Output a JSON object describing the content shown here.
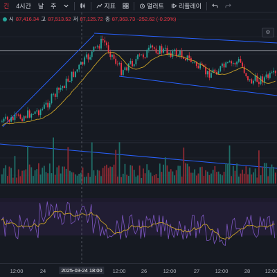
{
  "toolbar": {
    "items": [
      {
        "label": "긴",
        "icon": "none"
      },
      {
        "label": "4시간",
        "icon": "none"
      },
      {
        "label": "날",
        "icon": "none"
      },
      {
        "label": "주",
        "icon": "none"
      },
      {
        "label": "",
        "icon": "chevron-down-icon"
      },
      {
        "label": "",
        "icon": "candles-icon"
      },
      {
        "label": "지표",
        "icon": "indicator-icon"
      },
      {
        "label": "",
        "icon": "layout-grid-icon"
      },
      {
        "label": "얼러트",
        "icon": "alarm-icon"
      },
      {
        "label": "리플레이",
        "icon": "replay-icon"
      },
      {
        "label": "",
        "icon": "undo-icon"
      },
      {
        "label": "",
        "icon": "redo-icon"
      }
    ]
  },
  "ohlc": {
    "open_label": "시",
    "open": "87,416.34",
    "high_label": "고",
    "high": "87,513.52",
    "low_label": "저",
    "low": "87,125.72",
    "close_label": "종",
    "close": "87,363.73",
    "change": "-252.62 (-0.29%)"
  },
  "xaxis": {
    "labels": [
      {
        "text": "12:00"
      },
      {
        "text": "24"
      },
      {
        "text": "2025-03-24  18:00",
        "highlight": true
      },
      {
        "text": "12:00"
      },
      {
        "text": "26"
      },
      {
        "text": "12:00"
      },
      {
        "text": "27"
      },
      {
        "text": "12:00"
      },
      {
        "text": "28"
      },
      {
        "text": "12:00"
      }
    ]
  },
  "colors": {
    "up": "#26a69a",
    "down": "#f23645",
    "ma": "#c9a227",
    "trend": "#2962ff",
    "rsi": "#7e57c2"
  },
  "chart_data": {
    "type": "candlestick",
    "title": "",
    "candle_count": 150,
    "price_series_shape": "uptrend then descending channel",
    "volume_shown": true,
    "oscillator_shown": true
  }
}
